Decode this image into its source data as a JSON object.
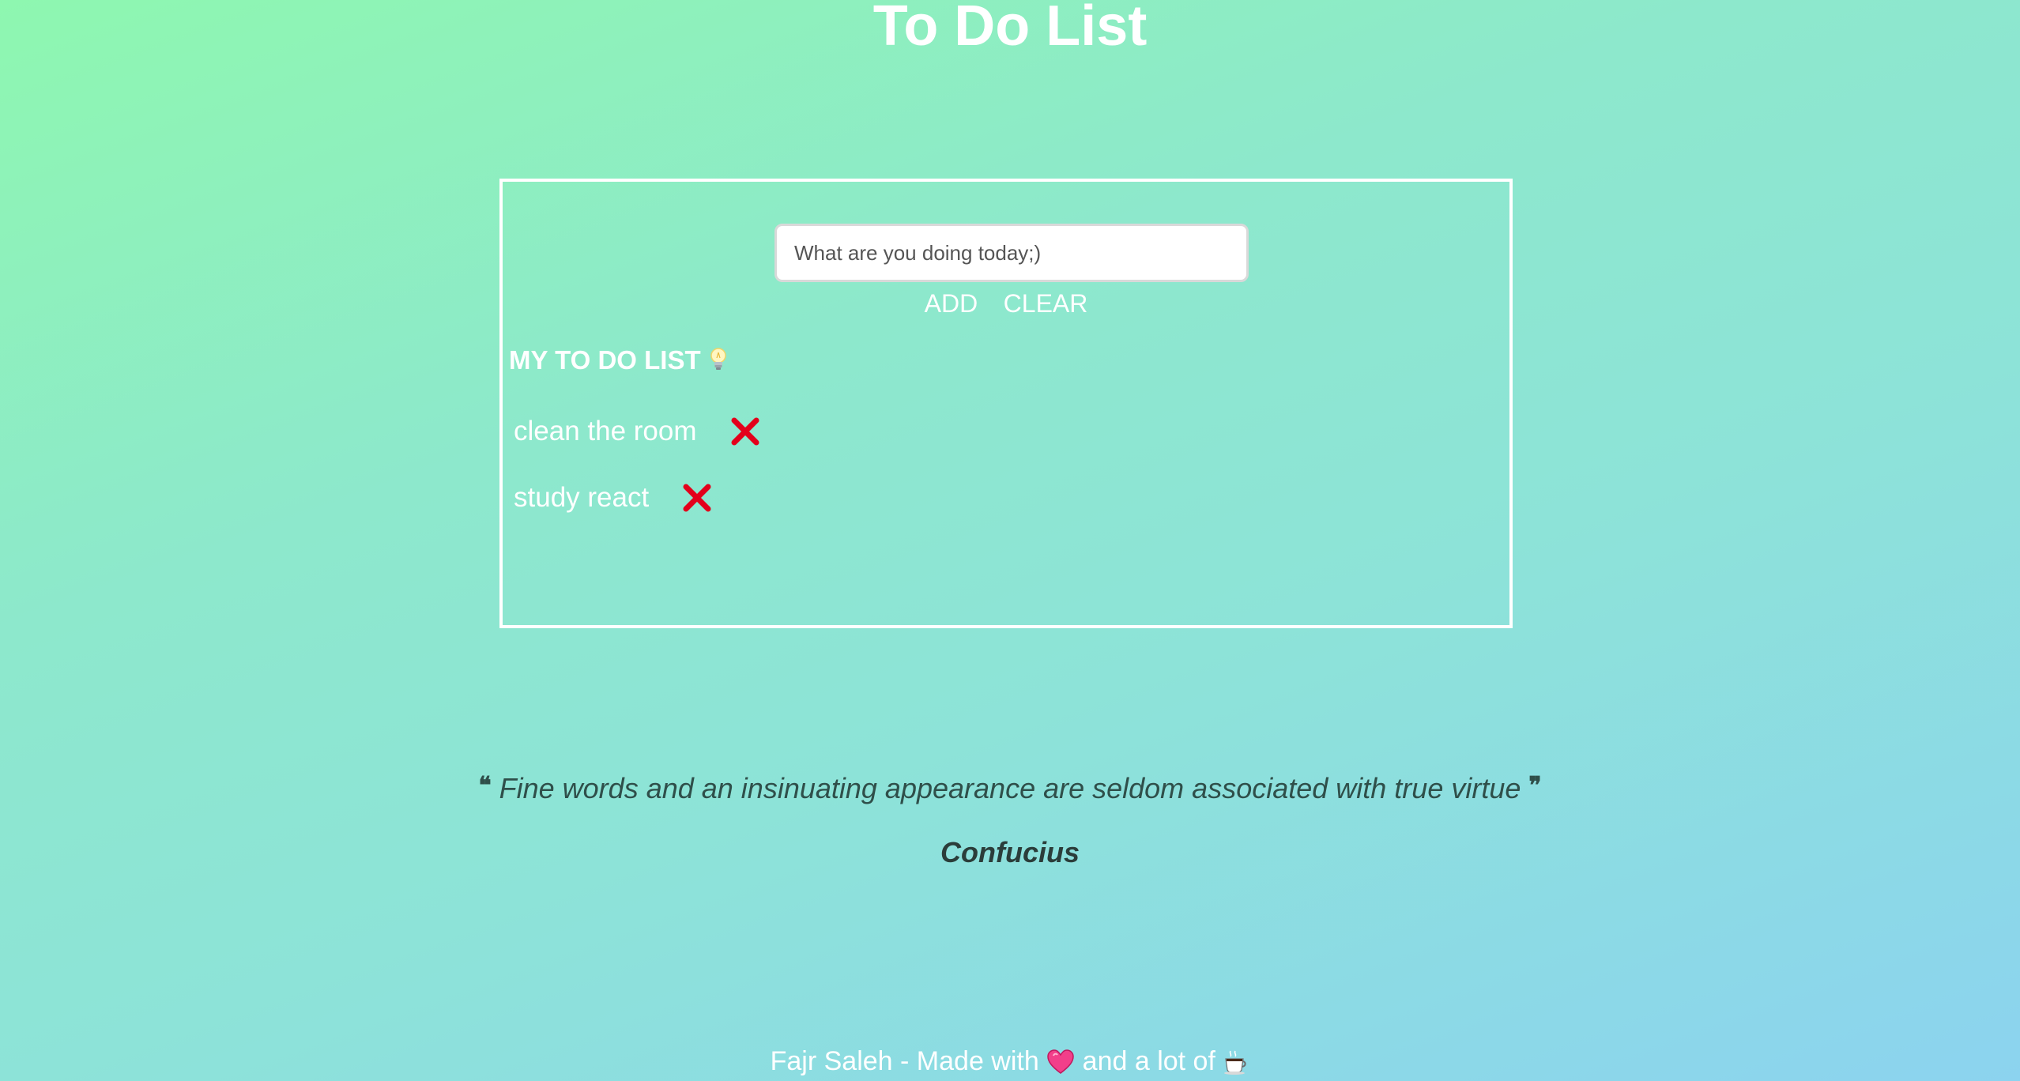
{
  "app": {
    "title": "To Do List"
  },
  "form": {
    "input_placeholder": "What are you doing today;)",
    "input_value": "",
    "add_label": "ADD",
    "clear_label": "CLEAR"
  },
  "list": {
    "heading": "MY TO DO LIST",
    "heading_icon": "lightbulb-icon",
    "items": [
      {
        "text": "clean the room",
        "delete_icon": "close-icon",
        "delete_color": "#e3001b"
      },
      {
        "text": "study react",
        "delete_icon": "close-icon",
        "delete_color": "#e3001b"
      }
    ]
  },
  "quote": {
    "text": "Fine words and an insinuating appearance are seldom associated with true virtue",
    "open_mark": "❝",
    "close_mark": "❞",
    "author": "Confucius"
  },
  "footer": {
    "prefix": "Fajr Saleh - Made with",
    "middle": "and a lot of",
    "heart_icon": "heart-icon",
    "coffee_icon": "coffee-icon"
  }
}
